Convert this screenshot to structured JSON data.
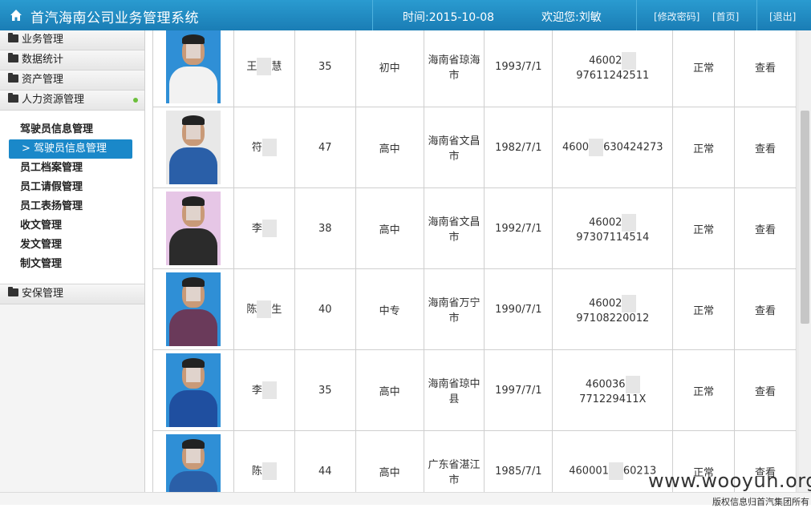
{
  "header": {
    "title": "首汽海南公司业务管理系统",
    "time_text": "时间:2015-10-08",
    "welcome_text": "欢迎您:刘敏",
    "change_password": "[修改密码]",
    "home": "[首页]",
    "logout": "[退出]"
  },
  "sidebar": {
    "menus": [
      {
        "label": "业务管理"
      },
      {
        "label": "数据统计"
      },
      {
        "label": "资产管理"
      },
      {
        "label": "人力资源管理"
      }
    ],
    "hr_submenu": [
      {
        "label": "驾驶员信息管理"
      },
      {
        "label": "> 驾驶员信息管理"
      },
      {
        "label": "员工档案管理"
      },
      {
        "label": "员工请假管理"
      },
      {
        "label": "员工表扬管理"
      },
      {
        "label": "收文管理"
      },
      {
        "label": "发文管理"
      },
      {
        "label": "制文管理"
      }
    ],
    "security_menu": "安保管理"
  },
  "table": {
    "rows": [
      {
        "name_a": "王",
        "name_b": "慧",
        "age": "35",
        "education": "初中",
        "origin": "海南省琼海市",
        "date": "1993/7/1",
        "id_a": "46002",
        "id_b": "97611242511",
        "status": "正常",
        "action": "查看",
        "shirt": "#f2f2f2",
        "bg": "#2f8fd6"
      },
      {
        "name_a": "符",
        "name_b": "",
        "age": "47",
        "education": "高中",
        "origin": "海南省文昌市",
        "date": "1982/7/1",
        "id_a": "4600",
        "id_b": "630424273",
        "status": "正常",
        "action": "查看",
        "shirt": "#2a5fa8",
        "bg": "#e8e8e8"
      },
      {
        "name_a": "李",
        "name_b": "",
        "age": "38",
        "education": "高中",
        "origin": "海南省文昌市",
        "date": "1992/7/1",
        "id_a": "46002",
        "id_b": "97307114514",
        "status": "正常",
        "action": "查看",
        "shirt": "#2b2b2b",
        "bg": "#e6c6e6"
      },
      {
        "name_a": "陈",
        "name_b": "生",
        "age": "40",
        "education": "中专",
        "origin": "海南省万宁市",
        "date": "1990/7/1",
        "id_a": "46002",
        "id_b": "97108220012",
        "status": "正常",
        "action": "查看",
        "shirt": "#6a3a5a",
        "bg": "#2f8fd6"
      },
      {
        "name_a": "李",
        "name_b": "",
        "age": "35",
        "education": "高中",
        "origin": "海南省琼中县",
        "date": "1997/7/1",
        "id_a": "460036",
        "id_b": "771229411X",
        "status": "正常",
        "action": "查看",
        "shirt": "#1f4fa0",
        "bg": "#2f8fd6"
      },
      {
        "name_a": "陈",
        "name_b": "",
        "age": "44",
        "education": "高中",
        "origin": "广东省湛江市",
        "date": "1985/7/1",
        "id_a": "460001",
        "id_b": "60213",
        "status": "正常",
        "action": "查看",
        "shirt": "#2a5fa8",
        "bg": "#2f8fd6"
      }
    ]
  },
  "watermark": "www.wooyun.org",
  "footer": "版权信息归首汽集团所有"
}
